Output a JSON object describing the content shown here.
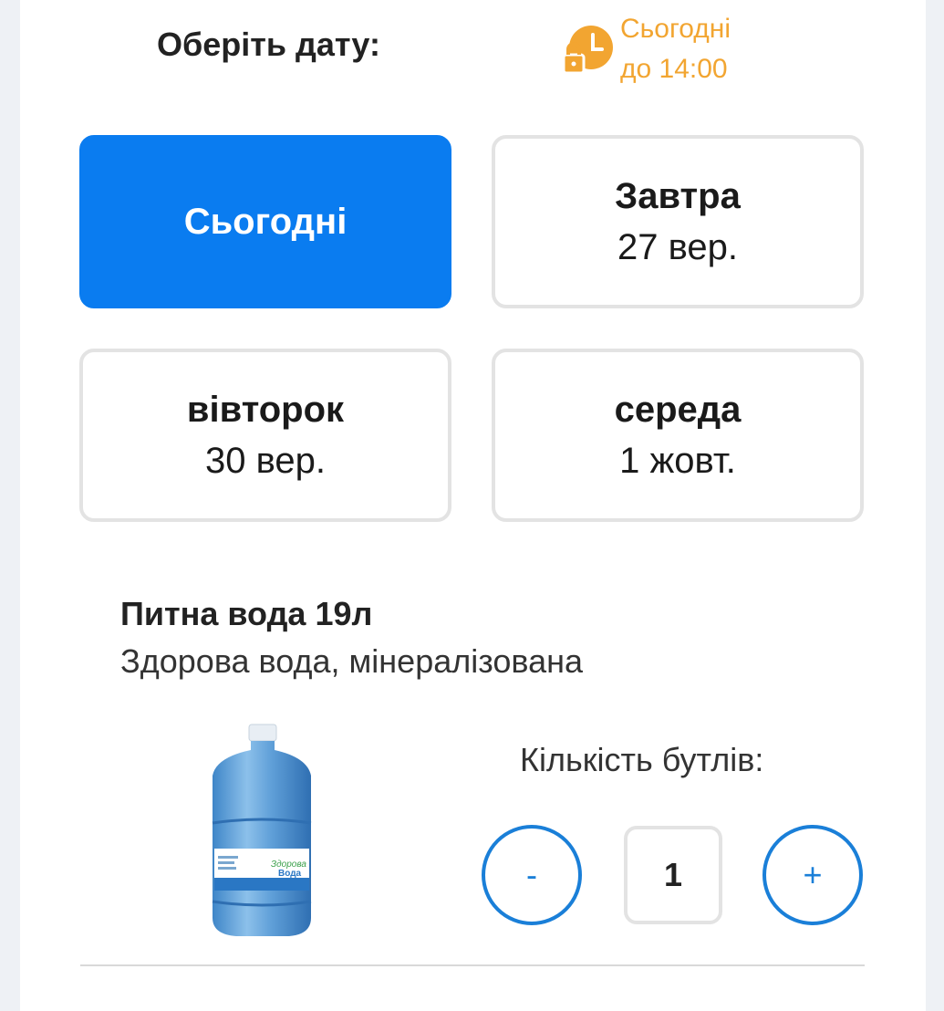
{
  "header": {
    "title": "Оберіть дату:",
    "badge_line1": "Сьогодні",
    "badge_line2": "до 14:00",
    "badge_icon": "clock-lock-icon",
    "badge_color": "#f2a531"
  },
  "dates": {
    "today": {
      "day": "Сьогодні"
    },
    "tomorrow": {
      "day": "Завтра",
      "date": "27 вер."
    },
    "tuesday": {
      "day": "вівторок",
      "date": "30 вер."
    },
    "wednesday": {
      "day": "середа",
      "date": "1 жовт."
    },
    "active_color": "#0a7cf0"
  },
  "product": {
    "name": "Питна вода 19л",
    "description": "Здорова вода, мінералізована",
    "label_brand_line1": "Здорова",
    "label_brand_line2": "Вода"
  },
  "quantity": {
    "label": "Кількість бутлів:",
    "minus_label": "-",
    "value": "1",
    "plus_label": "+",
    "accent_color": "#1a7fd8"
  }
}
